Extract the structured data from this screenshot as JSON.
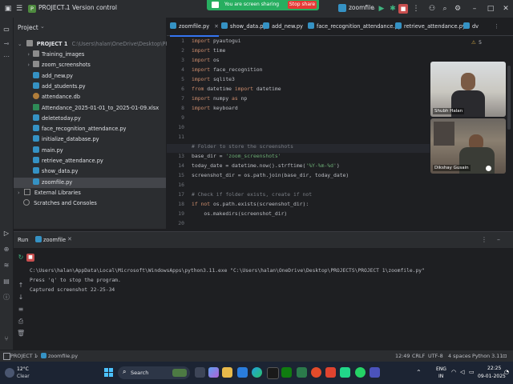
{
  "titlebar": {
    "project_badge": "P",
    "project_name": "PROJECT 1",
    "vcs_label": "Version control",
    "run_config": "zoomfile"
  },
  "screen_share": {
    "message": "You are screen sharing",
    "stop_label": "Stop share"
  },
  "project_panel": {
    "title": "Project",
    "root_name": "PROJECT 1",
    "root_path": "C:\\Users\\halan\\OneDrive\\Desktop\\PROJECTS\\PROJ",
    "items": [
      {
        "label": "Training_images",
        "kind": "folder"
      },
      {
        "label": "zoom_screenshots",
        "kind": "folder"
      },
      {
        "label": "add_new.py",
        "kind": "py"
      },
      {
        "label": "add_students.py",
        "kind": "py"
      },
      {
        "label": "attendance.db",
        "kind": "db"
      },
      {
        "label": "Attendance_2025-01-01_to_2025-01-09.xlsx",
        "kind": "xl"
      },
      {
        "label": "deletetoday.py",
        "kind": "py"
      },
      {
        "label": "face_recognition_attendance.py",
        "kind": "py"
      },
      {
        "label": "initialize_database.py",
        "kind": "py"
      },
      {
        "label": "main.py",
        "kind": "py"
      },
      {
        "label": "retrieve_attendance.py",
        "kind": "py"
      },
      {
        "label": "show_data.py",
        "kind": "py"
      },
      {
        "label": "zoomfile.py",
        "kind": "py"
      }
    ],
    "external_libraries": "External Libraries",
    "scratches": "Scratches and Consoles"
  },
  "editor": {
    "tabs": [
      "zoomfile.py",
      "show_data.py",
      "add_new.py",
      "face_recognition_attendance.py",
      "retrieve_attendance.py",
      "dv"
    ],
    "warning_count": "5",
    "line_numbers": [
      "1",
      "2",
      "3",
      "4",
      "5",
      "6",
      "7",
      "8",
      "9",
      "10",
      "11",
      "12",
      "13",
      "14",
      "15",
      "16",
      "17",
      "18",
      "19",
      "20"
    ]
  },
  "participants": {
    "top": "Shubh Halan",
    "bottom": "Dikshay Gusain"
  },
  "run_panel": {
    "run_label": "Run",
    "config_tab": "zoomfile",
    "console": [
      "C:\\Users\\halan\\AppData\\Local\\Microsoft\\WindowsApps\\python3.11.exe \"C:\\Users\\halan\\OneDrive\\Desktop\\PROJECTS\\PROJECT 1\\zoomfile.py\"",
      "Press 'q' to stop the program.",
      "Captured screenshot 22-25-34"
    ]
  },
  "statusbar": {
    "crumb_project": "PROJECT 1",
    "crumb_file": "zoomfile.py",
    "position": "12:49",
    "line_sep": "CRLF",
    "encoding": "UTF-8",
    "indent": "4 spaces",
    "interpreter": "Python 3.11"
  },
  "taskbar": {
    "weather_temp": "12°C",
    "weather_desc": "Clear",
    "search_placeholder": "Search",
    "lang_top": "ENG",
    "lang_bottom": "IN",
    "time": "22:25",
    "date": "09-01-2025"
  },
  "colors": {
    "accent": "#3574f0",
    "share_green": "#27ae60",
    "stop_red": "#e53935"
  }
}
